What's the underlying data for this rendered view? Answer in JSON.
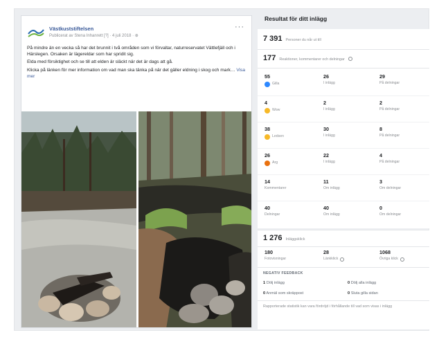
{
  "post": {
    "page_name": "Västkuststiftelsen",
    "meta": "Publicerat av Stena Inhanrett [?] · 4 juli 2018 · ",
    "more_label": "···",
    "paragraphs": [
      "På mindre än en vecka så har det brunnit i två områden som vi förvaltar, naturreservatet Vättlefjäll och i Härslegen. Orsaken är lägereldar som har spridit sig.",
      "Elda med försiktighet och se till att elden är släckt när det är dags att gå.",
      "Klicka på länken för mer information om vad man ska tänka på när det gäller eldning i skog och mark… "
    ],
    "see_more": "Visa mer"
  },
  "insights": {
    "title": "Resultat för ditt inlägg",
    "reach": {
      "value": "7 391",
      "label": "Personer du når ut till"
    },
    "engagement": {
      "value": "177",
      "label": "Reaktioner, kommentarer och delningar"
    },
    "reactions": [
      {
        "icon": "like-icon",
        "cls": "e-like",
        "label": "Gilla",
        "total": "55",
        "on_post": "26",
        "on_post_label": "I inlägg",
        "on_shares": "29",
        "on_shares_label": "På delningar"
      },
      {
        "icon": "wow-icon",
        "cls": "e-wow",
        "label": "Wow",
        "total": "4",
        "on_post": "2",
        "on_post_label": "I inlägg",
        "on_shares": "2",
        "on_shares_label": "På delningar"
      },
      {
        "icon": "sad-icon",
        "cls": "e-sad",
        "label": "Ledsen",
        "total": "38",
        "on_post": "30",
        "on_post_label": "I inlägg",
        "on_shares": "8",
        "on_shares_label": "På delningar"
      },
      {
        "icon": "angry-icon",
        "cls": "e-angry",
        "label": "Arg",
        "total": "26",
        "on_post": "22",
        "on_post_label": "I inlägg",
        "on_shares": "4",
        "on_shares_label": "På delningar"
      }
    ],
    "comments": {
      "total": "14",
      "label": "Kommentarer",
      "on_post": "11",
      "on_post_label": "Om inlägg",
      "on_shares": "3",
      "on_shares_label": "Om delningar"
    },
    "shares": {
      "total": "40",
      "label": "Delningar",
      "on_post": "40",
      "on_post_label": "Om inlägg",
      "on_shares": "0",
      "on_shares_label": "Om delningar"
    },
    "clicks": {
      "value": "1 276",
      "label": "Inläggsklick"
    },
    "click_breakdown": [
      {
        "value": "180",
        "label": "Fotovisningar"
      },
      {
        "value": "28",
        "label": "Länkklick"
      },
      {
        "value": "1068",
        "label": "Övriga klick"
      }
    ],
    "negative": {
      "title": "NEGATIV FEEDBACK",
      "items": [
        {
          "value": "1",
          "label": "Dölj inlägg"
        },
        {
          "value": "0",
          "label": "Dölj alla inlägg"
        },
        {
          "value": "0",
          "label": "Anmäl som skräppost"
        },
        {
          "value": "0",
          "label": "Sluta gilla sidan"
        }
      ]
    },
    "footnote": "Rapporterade statistik kan vara fördröjd i förhållande till vad som visas i inlägg"
  },
  "colors": {
    "link": "#385898",
    "like": "#2d88ff",
    "wow": "#f7b928",
    "angry": "#e9710f"
  }
}
